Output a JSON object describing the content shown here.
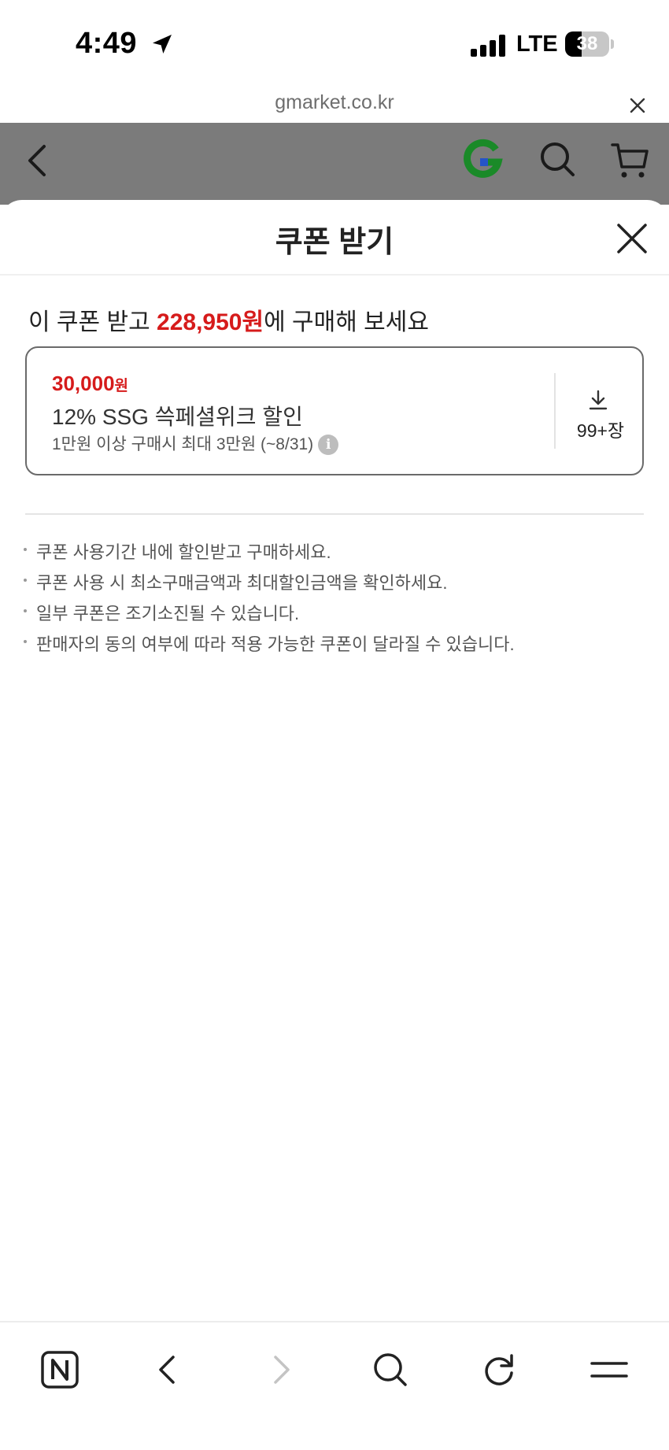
{
  "status_bar": {
    "time": "4:49",
    "network": "LTE",
    "battery": "38",
    "battery_level": 0.38
  },
  "browser": {
    "url": "gmarket.co.kr"
  },
  "site_header": {
    "logo_color": "#1a8a28",
    "icons": [
      "back-icon",
      "gmarket-logo",
      "search-icon",
      "cart-icon"
    ]
  },
  "coupon_sheet": {
    "title": "쿠폰 받기",
    "promo_prefix": "이 쿠폰 받고 ",
    "promo_price": "228,950원",
    "promo_suffix": "에 구매해 보세요",
    "coupon": {
      "amount": "30,000",
      "amount_unit": "원",
      "name": "12% SSG 쓱페셜위크 할인",
      "condition": "1만원 이상 구매시 최대 3만원 (~8/31)",
      "download_count": "99+장"
    },
    "notices": [
      "쿠폰 사용기간 내에 할인받고 구매하세요.",
      "쿠폰 사용 시 최소구매금액과 최대할인금액을 확인하세요.",
      "일부 쿠폰은 조기소진될 수 있습니다.",
      "판매자의 동의 여부에 따라 적용 가능한 쿠폰이 달라질 수 있습니다."
    ]
  },
  "colors": {
    "accent_red": "#d61b1b",
    "dim_overlay": "#7b7b7b"
  }
}
